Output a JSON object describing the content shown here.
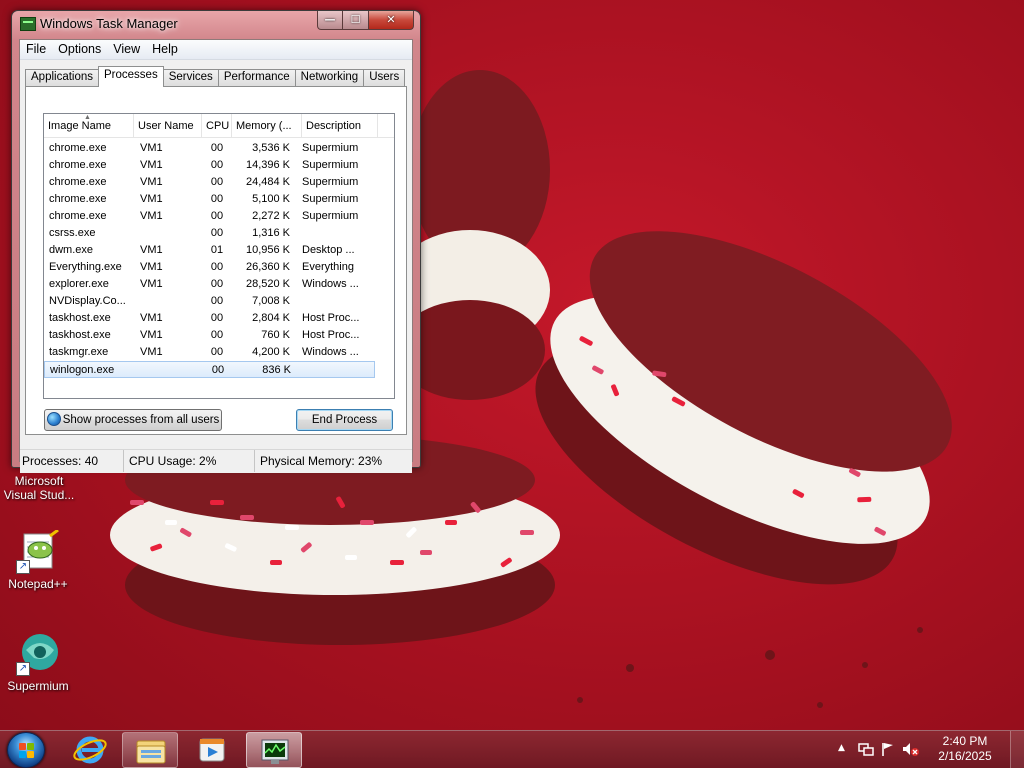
{
  "window": {
    "title": "Windows Task Manager",
    "caption": {
      "minimize": "—",
      "maximize": "☐",
      "close": "✕"
    },
    "menu": [
      "File",
      "Options",
      "View",
      "Help"
    ],
    "tabs": [
      "Applications",
      "Processes",
      "Services",
      "Performance",
      "Networking",
      "Users"
    ],
    "active_tab": "Processes",
    "columns": [
      "Image Name",
      "User Name",
      "CPU",
      "Memory (...",
      "Description"
    ],
    "sort_indicator": "▲",
    "processes": [
      {
        "name": "chrome.exe",
        "user": "VM1",
        "cpu": "00",
        "mem": "3,536 K",
        "desc": "Supermium"
      },
      {
        "name": "chrome.exe",
        "user": "VM1",
        "cpu": "00",
        "mem": "14,396 K",
        "desc": "Supermium"
      },
      {
        "name": "chrome.exe",
        "user": "VM1",
        "cpu": "00",
        "mem": "24,484 K",
        "desc": "Supermium"
      },
      {
        "name": "chrome.exe",
        "user": "VM1",
        "cpu": "00",
        "mem": "5,100 K",
        "desc": "Supermium"
      },
      {
        "name": "chrome.exe",
        "user": "VM1",
        "cpu": "00",
        "mem": "2,272 K",
        "desc": "Supermium"
      },
      {
        "name": "csrss.exe",
        "user": "",
        "cpu": "00",
        "mem": "1,316 K",
        "desc": ""
      },
      {
        "name": "dwm.exe",
        "user": "VM1",
        "cpu": "01",
        "mem": "10,956 K",
        "desc": "Desktop ..."
      },
      {
        "name": "Everything.exe",
        "user": "VM1",
        "cpu": "00",
        "mem": "26,360 K",
        "desc": "Everything"
      },
      {
        "name": "explorer.exe",
        "user": "VM1",
        "cpu": "00",
        "mem": "28,520 K",
        "desc": "Windows ..."
      },
      {
        "name": "NVDisplay.Co...",
        "user": "",
        "cpu": "00",
        "mem": "7,008 K",
        "desc": ""
      },
      {
        "name": "taskhost.exe",
        "user": "VM1",
        "cpu": "00",
        "mem": "2,804 K",
        "desc": "Host Proc..."
      },
      {
        "name": "taskhost.exe",
        "user": "VM1",
        "cpu": "00",
        "mem": "760 K",
        "desc": "Host Proc..."
      },
      {
        "name": "taskmgr.exe",
        "user": "VM1",
        "cpu": "00",
        "mem": "4,200 K",
        "desc": "Windows ..."
      },
      {
        "name": "winlogon.exe",
        "user": "",
        "cpu": "00",
        "mem": "836 K",
        "desc": ""
      }
    ],
    "selected_process": "winlogon.exe",
    "show_all_label": "Show processes from all users",
    "end_process_label": "End Process",
    "status": {
      "processes": "Processes: 40",
      "cpu": "CPU Usage: 2%",
      "memory": "Physical Memory: 23%"
    }
  },
  "desktop_icons": [
    {
      "id": "visual-studio",
      "label_line1": "Microsoft",
      "label_line2": "Visual Stud..."
    },
    {
      "id": "notepadpp",
      "label_line1": "Notepad++",
      "label_line2": ""
    },
    {
      "id": "supermium",
      "label_line1": "Supermium",
      "label_line2": ""
    }
  ],
  "taskbar": {
    "buttons": [
      "start-orb",
      "internet-explorer-icon",
      "file-explorer-icon",
      "media-player-icon",
      "task-manager-icon"
    ],
    "active": "task-manager-icon",
    "tray_arrow": "▲",
    "clock_time": "2:40 PM",
    "clock_date": "2/16/2025"
  },
  "colors": {
    "wallpaper": "#b3121f",
    "cookie": "#7a1a1f",
    "cream": "#f4f1ea",
    "window_frame": "#d1858b",
    "selection": "#dcebfc"
  }
}
